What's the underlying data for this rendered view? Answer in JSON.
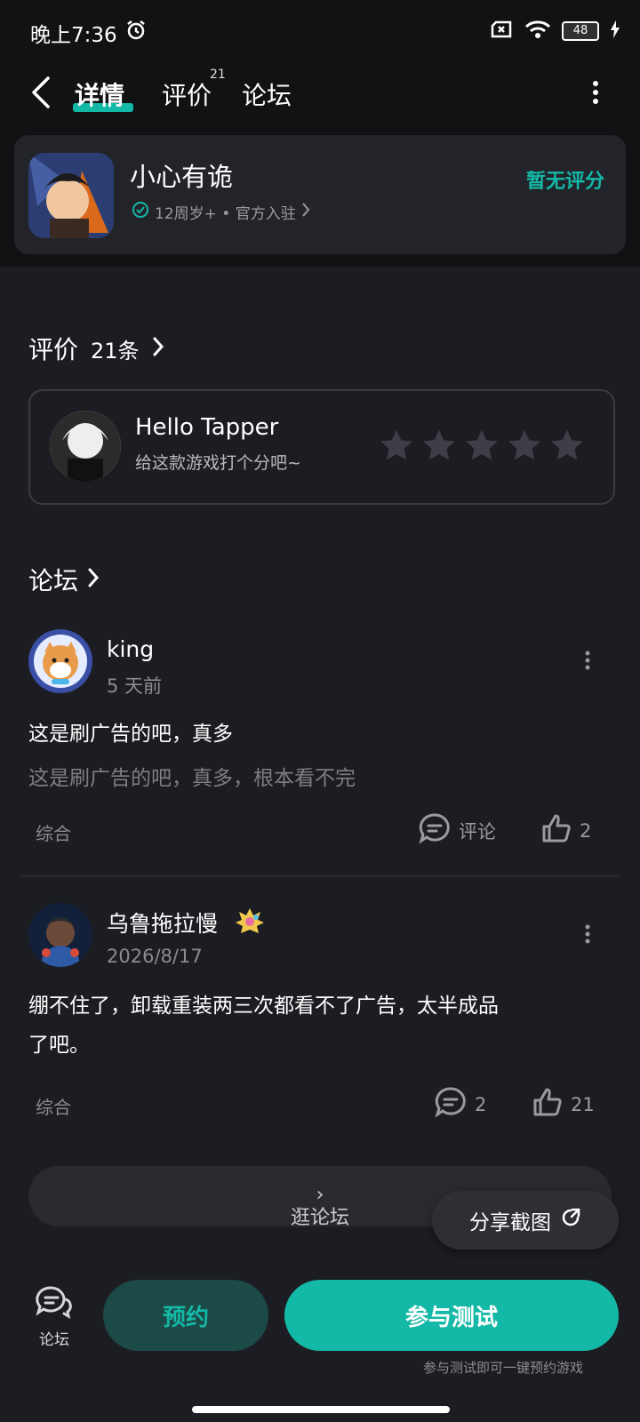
{
  "status": {
    "time": "晚上7:36",
    "battery": "48"
  },
  "nav": {
    "tabs": [
      {
        "label": "详情"
      },
      {
        "label": "评价"
      },
      {
        "label": "论坛"
      }
    ],
    "review_badge": "21"
  },
  "app": {
    "name": "小心有诡",
    "meta": "12周岁+ • 官方入驻",
    "rating_text": "暂无评分"
  },
  "reviews": {
    "title": "评价",
    "count": "21条",
    "user": "Hello Tapper",
    "prompt": "给这款游戏打个分吧~"
  },
  "forum": {
    "title": "论坛",
    "posts": [
      {
        "author": "king",
        "time": "5 天前",
        "title": "这是刷广告的吧，真多",
        "body": "这是刷广告的吧，真多，根本看不完",
        "tag": "综合",
        "comments": "评论",
        "likes": "2"
      },
      {
        "author": "乌鲁拖拉慢",
        "time": "2026/8/17",
        "body1": "绷不住了，卸载重装两三次都看不了广告，太半成品",
        "body2": "了吧。",
        "tag": "综合",
        "comments": "2",
        "likes": "21"
      }
    ],
    "browse_label": "逛论坛"
  },
  "share_label": "分享截图",
  "bottom": {
    "forum_label": "论坛",
    "reserve_label": "预约",
    "test_label": "参与测试",
    "test_note": "参与测试即可一键预约游戏"
  },
  "colors": {
    "accent": "#14b8a6",
    "background": "#1c1d22",
    "header": "#111214"
  }
}
